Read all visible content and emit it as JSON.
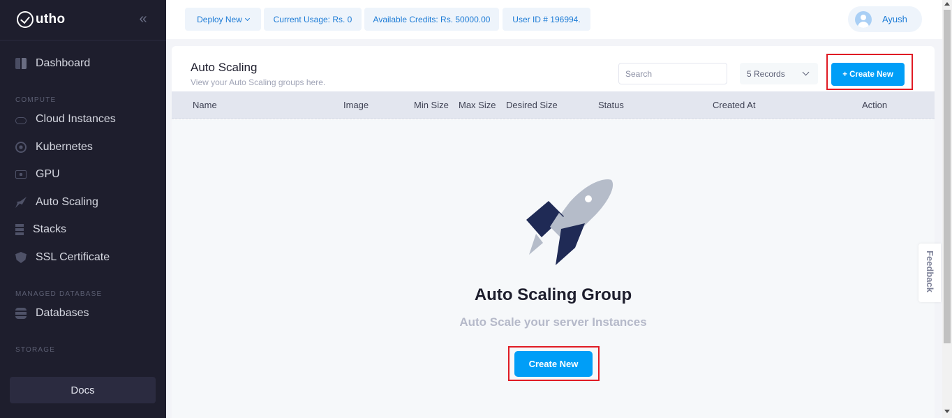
{
  "brand": {
    "name": "utho"
  },
  "sidebar": {
    "collapse_icon": "«",
    "items": [
      {
        "label": "Dashboard",
        "icon": "dashboard-icon"
      },
      {
        "label": "Cloud Instances",
        "icon": "cloud-icon"
      },
      {
        "label": "Kubernetes",
        "icon": "kubernetes-icon"
      },
      {
        "label": "GPU",
        "icon": "gpu-icon"
      },
      {
        "label": "Auto Scaling",
        "icon": "rocket-icon"
      },
      {
        "label": "Stacks",
        "icon": "stacks-icon"
      },
      {
        "label": "SSL Certificate",
        "icon": "shield-icon"
      },
      {
        "label": "Databases",
        "icon": "database-icon"
      }
    ],
    "sections": [
      "COMPUTE",
      "MANAGED DATABASE",
      "STORAGE"
    ],
    "docs_label": "Docs"
  },
  "topbar": {
    "deploy_label": "Deploy New",
    "usage": "Current Usage: Rs. 0",
    "credits": "Available Credits: Rs. 50000.00",
    "user_id": "User ID # 196994.",
    "user_name": "Ayush"
  },
  "page": {
    "title": "Auto Scaling",
    "subtitle": "View your Auto Scaling groups here.",
    "search_placeholder": "Search",
    "records_label": "5 Records",
    "create_button": "+ Create New",
    "columns": [
      "Name",
      "Image",
      "Min Size",
      "Max Size",
      "Desired Size",
      "Status",
      "Created At",
      "Action"
    ]
  },
  "empty_state": {
    "title": "Auto Scaling Group",
    "subtitle": "Auto Scale your server Instances",
    "button": "Create New"
  },
  "feedback_label": "Feedback",
  "colors": {
    "accent": "#009ef7",
    "sidebar": "#1e1e2d",
    "highlight": "#e01b24"
  }
}
